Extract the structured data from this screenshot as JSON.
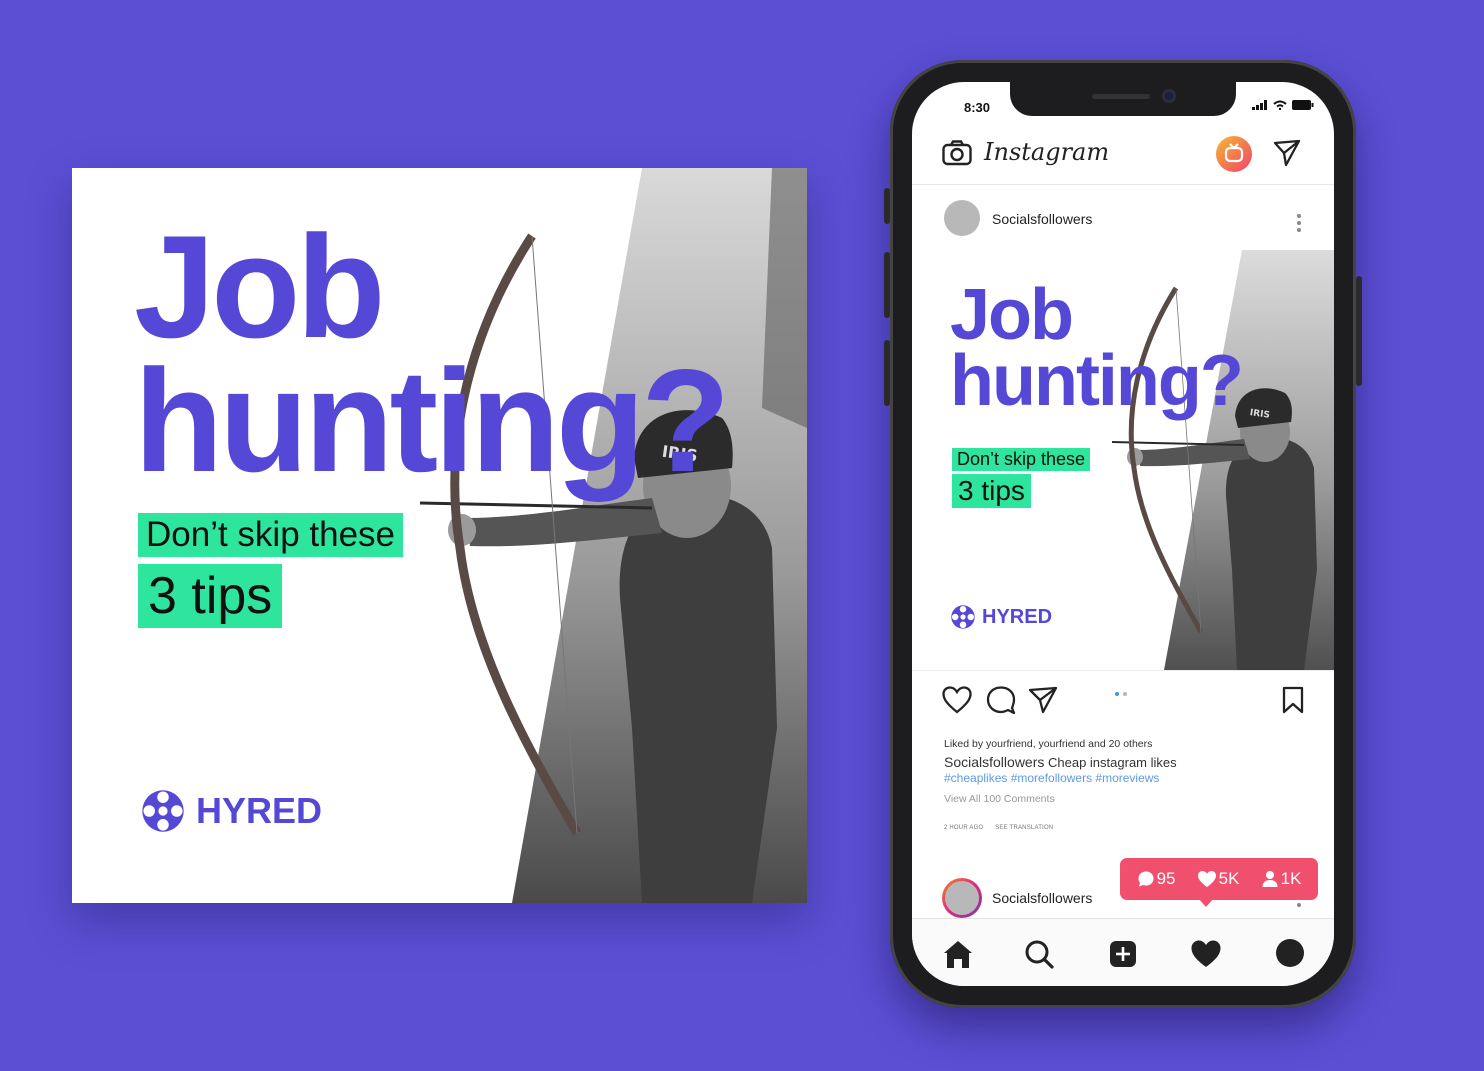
{
  "ad": {
    "headline_line1": "Job",
    "headline_line2": "hunting?",
    "tag_line1": "Don’t skip these",
    "tag_line2": "3 tips",
    "brand_name": "HYRED"
  },
  "phone": {
    "status_time": "8:30",
    "app_name": "Instagram",
    "post_username": "Socialsfollowers",
    "likes_text": "Liked by yourfriend, yourfriend and 20 others",
    "caption_user": "Socialsfollowers",
    "caption_text": "Cheap instagram likes",
    "hashtags": "#cheaplikes #morefollowers #moreviews",
    "view_all": "View All 100 Comments",
    "time_ago": "2 HOUR AGO",
    "see_translation": "SEE TRANSLATION",
    "comment_username": "Socialsfollowers",
    "notifications": {
      "comments": "95",
      "likes": "5K",
      "followers": "1K"
    }
  },
  "colors": {
    "background": "#5b4fd4",
    "brand_purple": "#5548d6",
    "tag_green": "#2ee59d",
    "notification_red": "#f0506e"
  }
}
